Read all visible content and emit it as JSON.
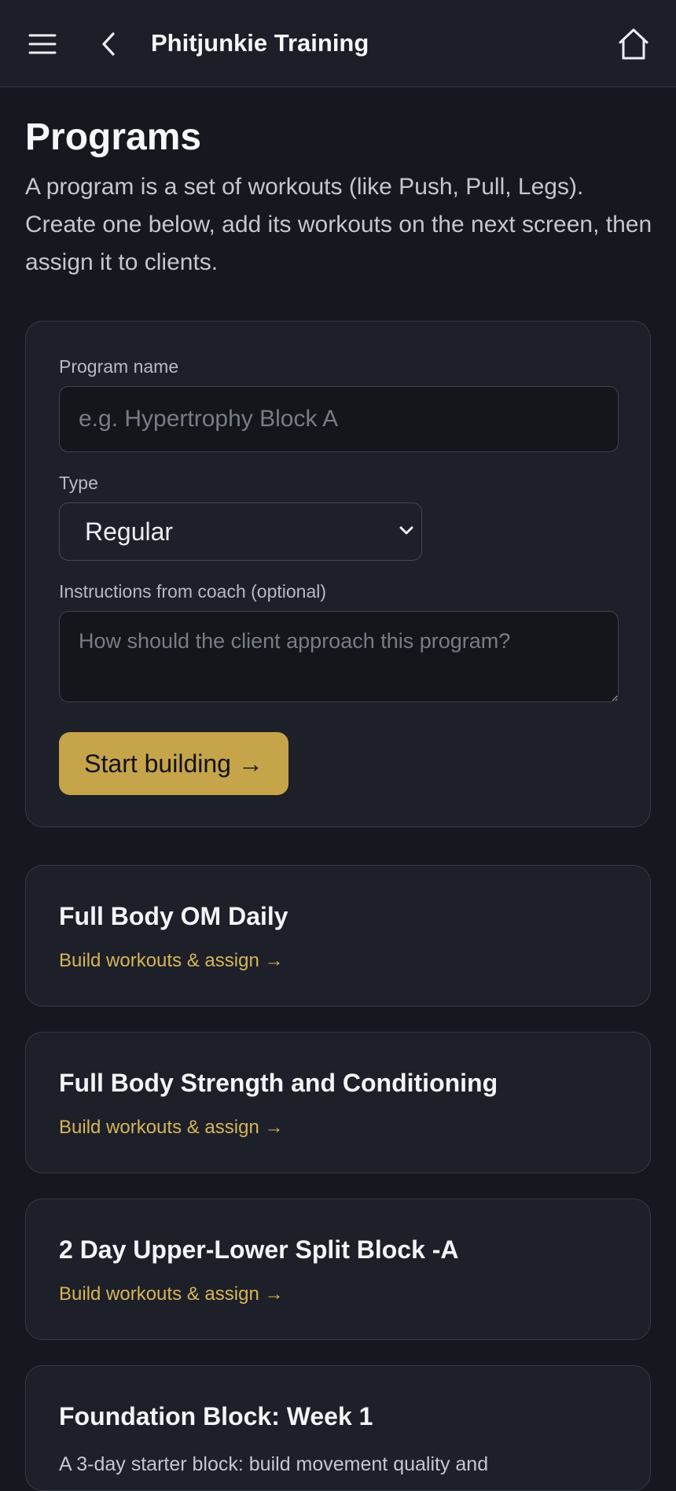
{
  "header": {
    "title": "Phitjunkie Training",
    "icons": [
      "menu-icon",
      "back-icon",
      "home-icon"
    ]
  },
  "page": {
    "title": "Programs",
    "intro": "A program is a set of workouts (like Push, Pull, Legs). Create one below, add its workouts on the next screen, then assign it to clients."
  },
  "form": {
    "name_label": "Program name",
    "name_value": "",
    "name_placeholder": "e.g. Hypertrophy Block A",
    "type_label": "Type",
    "type_value": "Regular",
    "instructions_label": "Instructions from coach (optional)",
    "instructions_value": "",
    "instructions_placeholder": "How should the client approach this program?",
    "submit_label": "Start building →"
  },
  "programs": [
    {
      "name": "Full Body OM Daily",
      "link": "Build workouts & assign →"
    },
    {
      "name": "Full Body Strength and Conditioning",
      "link": "Build workouts & assign →"
    },
    {
      "name": "2 Day Upper-Lower Split Block -A",
      "link": "Build workouts & assign →"
    },
    {
      "name": "Foundation Block: Week 1",
      "description": "A 3-day starter block: build movement quality and"
    }
  ],
  "colors": {
    "background": "#15181e",
    "surface": "#1d2029",
    "accent": "#c6a44a",
    "link": "#d6b458"
  }
}
